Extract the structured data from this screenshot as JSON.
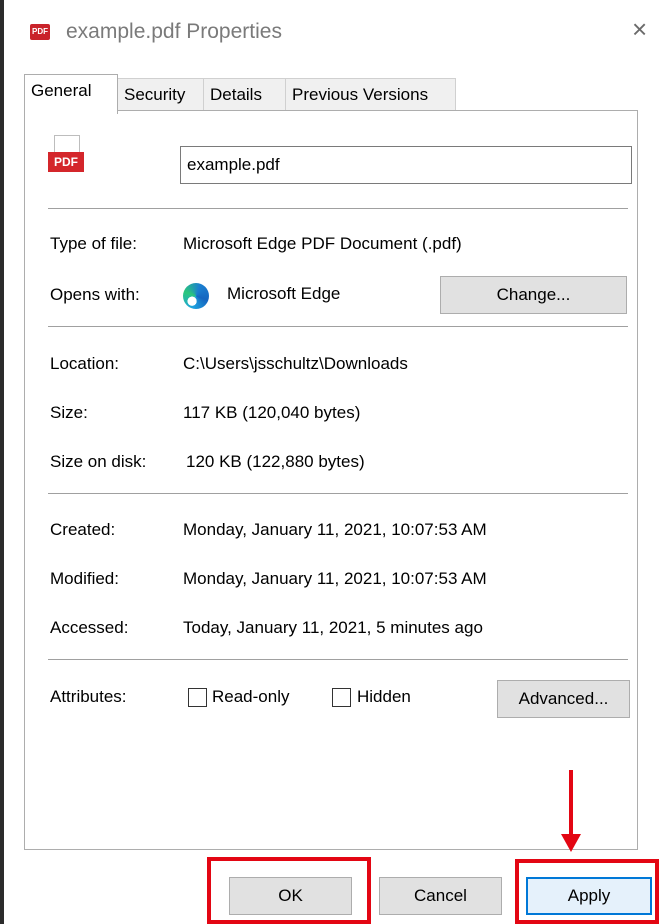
{
  "window": {
    "title": "example.pdf Properties",
    "icon_label": "PDF",
    "close_symbol": "×"
  },
  "tabs": [
    {
      "label": "General",
      "active": true
    },
    {
      "label": "Security",
      "active": false
    },
    {
      "label": "Details",
      "active": false
    },
    {
      "label": "Previous Versions",
      "active": false
    }
  ],
  "general": {
    "file_icon_label": "PDF",
    "filename": "example.pdf",
    "type_label": "Type of file:",
    "type_value": "Microsoft Edge PDF Document (.pdf)",
    "opens_label": "Opens with:",
    "opens_value": "Microsoft Edge",
    "change_button": "Change...",
    "location_label": "Location:",
    "location_value": "C:\\Users\\jsschultz\\Downloads",
    "size_label": "Size:",
    "size_value": "117 KB (120,040 bytes)",
    "size_on_disk_label": "Size on disk:",
    "size_on_disk_value": "120 KB (122,880 bytes)",
    "created_label": "Created:",
    "created_value": "Monday, January 11, 2021, 10:07:53 AM",
    "modified_label": "Modified:",
    "modified_value": "Monday, January 11, 2021, 10:07:53 AM",
    "accessed_label": "Accessed:",
    "accessed_value": "Today, January 11, 2021, 5 minutes ago",
    "attributes_label": "Attributes:",
    "readonly_label": "Read-only",
    "readonly_checked": false,
    "hidden_label": "Hidden",
    "hidden_checked": false,
    "advanced_button": "Advanced..."
  },
  "footer": {
    "ok_button": "OK",
    "cancel_button": "Cancel",
    "apply_button": "Apply"
  },
  "annotations": {
    "highlight_color": "#e30613",
    "highlighted": [
      "OK",
      "Apply"
    ]
  },
  "colors": {
    "focus_border": "#0078d7",
    "pdf_red": "#d4262b"
  }
}
